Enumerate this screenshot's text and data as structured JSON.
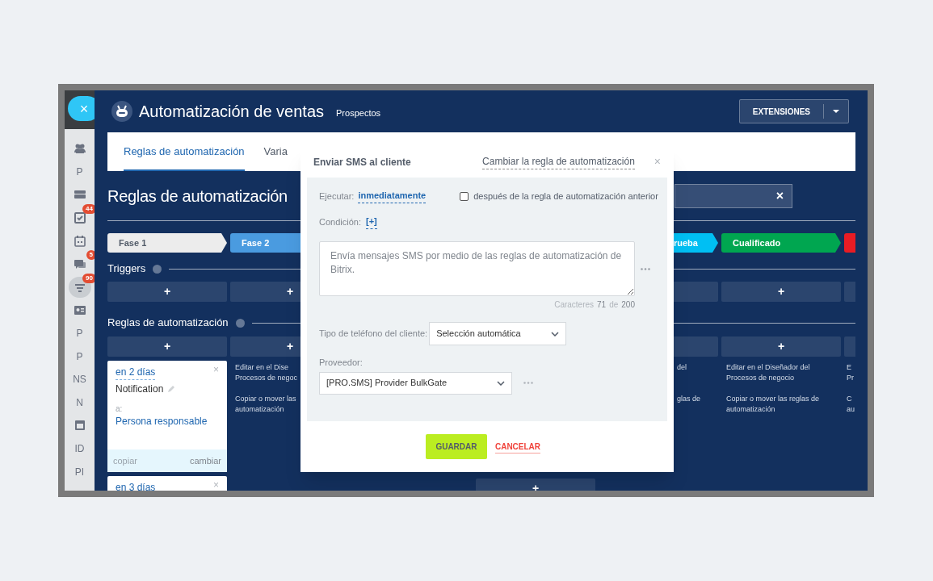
{
  "close_button": {
    "label": "×"
  },
  "sidebar": {
    "items": [
      {
        "kind": "people",
        "selected": false
      },
      {
        "kind": "letter",
        "label": "P",
        "selected": false
      },
      {
        "kind": "drive",
        "selected": false
      },
      {
        "kind": "tasks",
        "badge": "44",
        "selected": false
      },
      {
        "kind": "calendar",
        "selected": false
      },
      {
        "kind": "chat",
        "badge": "5",
        "selected": false
      },
      {
        "kind": "filter",
        "badge": "90",
        "selected": true
      },
      {
        "kind": "contact",
        "selected": false
      },
      {
        "kind": "letter",
        "label": "P",
        "selected": false
      },
      {
        "kind": "letter",
        "label": "P",
        "selected": false
      },
      {
        "kind": "letter",
        "label": "NS",
        "selected": false
      },
      {
        "kind": "letter",
        "label": "N",
        "selected": false
      },
      {
        "kind": "window",
        "selected": false
      },
      {
        "kind": "letter",
        "label": "ID",
        "selected": false
      },
      {
        "kind": "letter",
        "label": "PI",
        "selected": false
      }
    ]
  },
  "header": {
    "title": "Automatización de ventas",
    "subtitle": "Prospectos",
    "extensions_button": "EXTENSIONES"
  },
  "tabs": [
    {
      "label": "Reglas de automatización",
      "selected": true
    },
    {
      "label": "Varia",
      "selected": false
    }
  ],
  "page_title": "Reglas de automatización",
  "filter_field": {
    "clear": "×"
  },
  "triggers_heading": "Triggers",
  "rules_heading": "Reglas de automatización",
  "columns": [
    {
      "phase": {
        "label": "Fase 1",
        "color": "#ececec"
      },
      "trigger_add": "+",
      "rule_add": "+",
      "cards": [
        {
          "delay": "en 2 días",
          "close": "×",
          "title": "Notification",
          "to_label": "a:",
          "to_value": "Persona responsable",
          "copy": "copiar",
          "copy_disabled": true,
          "change": "cambiar"
        },
        {
          "delay": "en 3 días",
          "close": "×"
        }
      ]
    },
    {
      "phase": {
        "label": "Fase 2",
        "color": "#4a9be0"
      },
      "trigger_add": "+",
      "rule_add": "+",
      "notes": [
        [
          "Editar en el Dise",
          "Procesos de negoc"
        ],
        [
          "Copiar o mover las",
          "automatización"
        ]
      ]
    },
    {
      "bottom_add": "+"
    },
    {
      "phase": {
        "label": "rueba",
        "color": "#00bff3"
      },
      "notes": [
        [
          "del"
        ],
        [
          "glas de"
        ]
      ]
    },
    {
      "phase": {
        "label": "Cualificado",
        "color": "#00a650"
      },
      "trigger_add": "+",
      "rule_add": "+",
      "notes": [
        [
          "Editar en el Diseñador del",
          "Procesos de negocio"
        ],
        [
          "Copiar o mover las reglas de",
          "automatización"
        ]
      ]
    },
    {
      "phase": {
        "color": "#e81c24"
      },
      "notes": [
        [
          "E",
          "Pr"
        ],
        [
          "C",
          "au"
        ]
      ]
    }
  ],
  "modal": {
    "title": "Enviar SMS al cliente",
    "change_link": "Cambiar la regla de automatización",
    "close": "×",
    "execute_label": "Ejecutar:",
    "execute_value": "inmediatamente",
    "after_previous": {
      "label": "después de la regla de automatización anterior",
      "checked": false
    },
    "condition_label": "Condición:",
    "condition_add": "[+]",
    "message": "Envía mensajes SMS por medio de las reglas de automatización de Bitrix.",
    "counter": {
      "label": "Caracteres",
      "count": "71",
      "of": "de",
      "max": "200"
    },
    "phone_type": {
      "label": "Tipo de teléfono del cliente:",
      "value": "Selección automática"
    },
    "provider": {
      "label": "Proveedor:",
      "value": "[PRO.SMS] Provider BulkGate"
    },
    "save": "GUARDAR",
    "cancel": "CANCELAR"
  }
}
